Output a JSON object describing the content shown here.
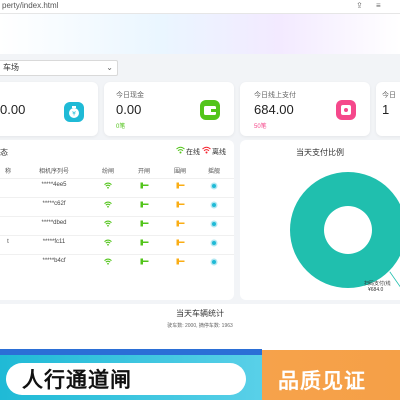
{
  "browser": {
    "url": "perty/index.html"
  },
  "filter": {
    "lot_value": "车场"
  },
  "cards": [
    {
      "title": "",
      "value": "0.00",
      "sub": "",
      "icon": "money-bag-icon",
      "color": "#1fbad6"
    },
    {
      "title": "今日现金",
      "value": "0.00",
      "sub": "0笔",
      "icon": "wallet-icon",
      "color": "#52c41a"
    },
    {
      "title": "今日线上支付",
      "value": "684.00",
      "sub": "50笔",
      "icon": "payment-card-icon",
      "color": "#f5488b"
    },
    {
      "title": "今日",
      "value": "1",
      "sub": "",
      "icon": "stat-icon",
      "color": "#faad14"
    }
  ],
  "device_panel": {
    "title": "态",
    "legend_online": "在线",
    "legend_offline": "离线",
    "columns": [
      "称",
      "相机序列号",
      "纷闸",
      "开闸",
      "围闸",
      "摇舰"
    ],
    "rows": [
      {
        "name": "",
        "serial": "*****4ee5"
      },
      {
        "name": "",
        "serial": "*****c62f"
      },
      {
        "name": "",
        "serial": "*****dbed"
      },
      {
        "name": "t",
        "serial": "*****fc11"
      },
      {
        "name": "",
        "serial": "*****b4cf"
      }
    ]
  },
  "pay_panel": {
    "title": "当天支付比例",
    "slice_label": "扫码支付(线",
    "slice_value": "¥684.0",
    "chart_data": {
      "type": "pie",
      "title": "当天支付比例",
      "categories": [
        "扫码支付(线"
      ],
      "values": [
        684.0
      ],
      "colors": [
        "#20bfae"
      ]
    }
  },
  "vehicle_stats": {
    "title": "当天车辆统计",
    "subtitle": "驶车数: 2000, 摘停车数: 1963"
  },
  "banner": {
    "left_text": "人行通道闸",
    "right_text": "品质见证"
  },
  "colors": {
    "online": "#52c41a",
    "offline": "#f5222d",
    "accent": "#1fbad6",
    "orange": "#f6a24b"
  }
}
